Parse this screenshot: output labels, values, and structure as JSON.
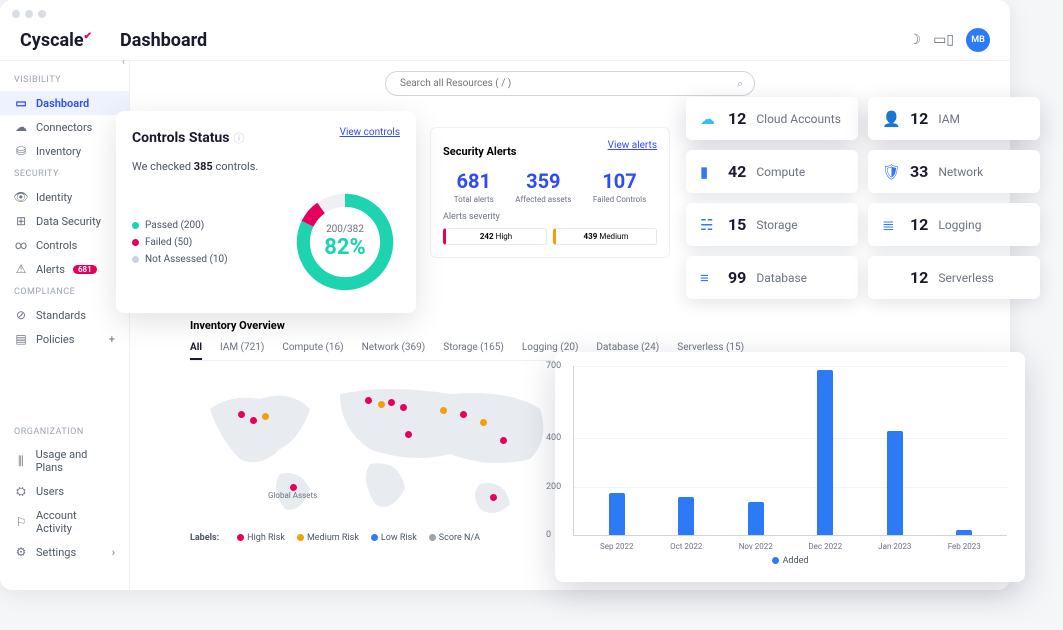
{
  "app": {
    "name": "Cyscale",
    "page_title": "Dashboard",
    "avatar": "MB"
  },
  "search": {
    "placeholder": "Search all Resources ( / )"
  },
  "sidebar": {
    "sections": [
      {
        "label": "VISIBILITY",
        "items": [
          {
            "icon": "▭",
            "label": "Dashboard",
            "active": true
          },
          {
            "icon": "☁",
            "label": "Connectors"
          },
          {
            "icon": "⛁",
            "label": "Inventory"
          }
        ]
      },
      {
        "label": "SECURITY",
        "items": [
          {
            "icon": "👁",
            "label": "Identity"
          },
          {
            "icon": "⊞",
            "label": "Data Security"
          },
          {
            "icon": "∞",
            "label": "Controls"
          },
          {
            "icon": "⚠",
            "label": "Alerts",
            "badge": "681"
          }
        ]
      },
      {
        "label": "COMPLIANCE",
        "items": [
          {
            "icon": "⊘",
            "label": "Standards"
          },
          {
            "icon": "▤",
            "label": "Policies",
            "plus": true
          }
        ]
      },
      {
        "label": "ORGANIZATION",
        "items": [
          {
            "icon": "⫼",
            "label": "Usage and Plans"
          },
          {
            "icon": "⛭",
            "label": "Users"
          },
          {
            "icon": "⚐",
            "label": "Account Activity"
          },
          {
            "icon": "⚙",
            "label": "Settings",
            "chevron": true
          }
        ]
      }
    ]
  },
  "controls": {
    "title": "Controls Status",
    "view": "View controls",
    "checked_prefix": "We checked ",
    "checked_count": "385",
    "checked_suffix": " controls.",
    "legend": [
      {
        "color": "#1dd3b0",
        "label": "Passed (200)"
      },
      {
        "color": "#e6005c",
        "label": "Failed (50)"
      },
      {
        "color": "#cbd2dd",
        "label": "Not Assessed (10)"
      }
    ],
    "ratio": "200/382",
    "percent": "82%"
  },
  "alerts": {
    "title": "Security Alerts",
    "view": "View alerts",
    "stats": [
      {
        "num": "681",
        "lbl": "Total alerts"
      },
      {
        "num": "359",
        "lbl": "Affected assets"
      },
      {
        "num": "107",
        "lbl": "Failed Controls"
      }
    ],
    "sev_title": "Alerts severity",
    "severities": [
      {
        "color": "#e6005c",
        "count": "242",
        "label": "High"
      },
      {
        "color": "#f59e0b",
        "count": "439",
        "label": "Medium"
      }
    ]
  },
  "tiles": [
    {
      "icon": "☁",
      "color": "#38bdf8",
      "num": "12",
      "label": "Cloud Accounts",
      "big": true
    },
    {
      "icon": "👤",
      "color": "#2d7af6",
      "num": "12",
      "label": "IAM",
      "big": true
    },
    {
      "icon": "▮",
      "color": "#2d7af6",
      "num": "42",
      "label": "Compute"
    },
    {
      "icon": "🛡",
      "color": "#2d7af6",
      "num": "33",
      "label": "Network"
    },
    {
      "icon": "☵",
      "color": "#2d7af6",
      "num": "15",
      "label": "Storage"
    },
    {
      "icon": "≣",
      "color": "#2d7af6",
      "num": "12",
      "label": "Logging"
    },
    {
      "icon": "≡",
      "color": "#2d7af6",
      "num": "99",
      "label": "Database"
    },
    {
      "icon": "</>",
      "color": "#2d7af6",
      "num": "12",
      "label": "Serverless"
    }
  ],
  "inventory": {
    "title": "Inventory Overview",
    "tabs": [
      {
        "label": "All",
        "active": true
      },
      {
        "label": "IAM (721)"
      },
      {
        "label": "Compute (16)"
      },
      {
        "label": "Network (369)"
      },
      {
        "label": "Storage (165)"
      },
      {
        "label": "Logging (20)"
      },
      {
        "label": "Database (24)"
      },
      {
        "label": "Serverless (15)"
      }
    ],
    "map_caption": "Global Assets",
    "legend_title": "Labels:",
    "legend": [
      {
        "color": "#e6005c",
        "label": "High Risk"
      },
      {
        "color": "#f59e0b",
        "label": "Medium Risk"
      },
      {
        "color": "#2d7af6",
        "label": "Low Risk"
      },
      {
        "color": "#9ca3af",
        "label": "Score N/A"
      }
    ]
  },
  "chart_data": {
    "type": "bar",
    "title": "",
    "xlabel": "",
    "ylabel": "",
    "categories": [
      "Sep 2022",
      "Oct 2022",
      "Nov 2022",
      "Dec 2022",
      "Jan 2023",
      "Feb 2023"
    ],
    "series": [
      {
        "name": "Added",
        "values": [
          175,
          155,
          135,
          680,
          430,
          20
        ]
      }
    ],
    "ylim": [
      0,
      700
    ],
    "yticks": [
      0,
      200,
      400,
      700
    ]
  }
}
